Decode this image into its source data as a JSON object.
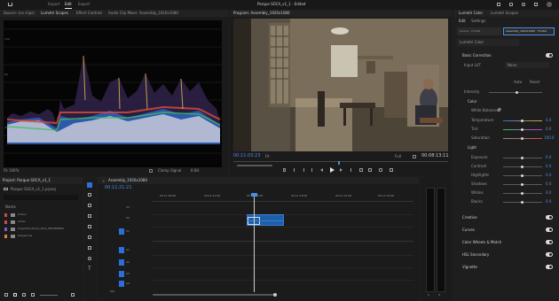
{
  "app": {
    "window_title": "Parque SOCA_v1_1 - Edited",
    "top_tabs": [
      "Import",
      "Edit",
      "Export"
    ],
    "active_tab": "Edit"
  },
  "source_panel": {
    "tabs": [
      "Source: (no clips)",
      "Lumetri Scopes",
      "Effect Controls",
      "Audio Clip Mixer: Assembly_1920x1080"
    ],
    "footer_left": "Fit 100%",
    "footer_buttons": [
      "Clamp Signal",
      "8 Bit"
    ]
  },
  "program_monitor": {
    "title": "Program: Assembly_1920x1080",
    "timecode_left": "00:11:03:23",
    "fit": "Fit",
    "quality": "Full",
    "timecode_right": "00:08:13:11"
  },
  "project_panel": {
    "title": "Project: Parque SOCA_v1_1",
    "path": "Parque SOCA_v1_1.prproj",
    "column_name": "Name",
    "items": [
      {
        "label": "Colour",
        "color": "#c94a4a"
      },
      {
        "label": "Audio",
        "color": "#c94a4a"
      },
      {
        "label": "Ungraded_Proxy_Files_WB.PRORES",
        "color": "#7b5fc9"
      },
      {
        "label": "Sequences",
        "color": "#d8813a"
      }
    ]
  },
  "timeline": {
    "title": "Assembly_1920x1080",
    "timecode": "00:11:21:21",
    "ruler": [
      "00:11:09:00",
      "00:11:12:00",
      "00:11:15:00",
      "00:11:18:00",
      "00:11:21:00",
      "00:11:24:00"
    ],
    "tracks": [
      "V3",
      "V2",
      "V1",
      "A1",
      "A2",
      "A3",
      "A4",
      "Mix"
    ]
  },
  "lumetri": {
    "tabs": [
      "Lumetri Color",
      "Lumetri Scopes"
    ],
    "subtabs": [
      "Edit",
      "Settings"
    ],
    "source_clip": "Source · FX-001",
    "seq_clip": "Assembly_1920x1080 · FX-001",
    "preset_label": "Lumetri Color",
    "sections": {
      "basic": "Basic Correction",
      "input_lut": "Input LUT",
      "input_lut_value": "None",
      "auto": "Auto",
      "reset": "Reset",
      "intensity": "Intensity",
      "color": "Color",
      "white_balance": "White Balance",
      "light": "Light"
    },
    "color_sliders": [
      {
        "label": "Temperature",
        "value": "0.0"
      },
      {
        "label": "Tint",
        "value": "0.0"
      },
      {
        "label": "Saturation",
        "value": "100.0"
      }
    ],
    "light_sliders": [
      {
        "label": "Exposure",
        "value": "0.0"
      },
      {
        "label": "Contrast",
        "value": "0.0"
      },
      {
        "label": "Highlights",
        "value": "0.0"
      },
      {
        "label": "Shadows",
        "value": "0.0"
      },
      {
        "label": "Whites",
        "value": "0.0"
      },
      {
        "label": "Blacks",
        "value": "0.0"
      }
    ],
    "collapsed_sections": [
      "Creative",
      "Curves",
      "Color Wheels & Match",
      "HSL Secondary",
      "Vignette"
    ]
  }
}
